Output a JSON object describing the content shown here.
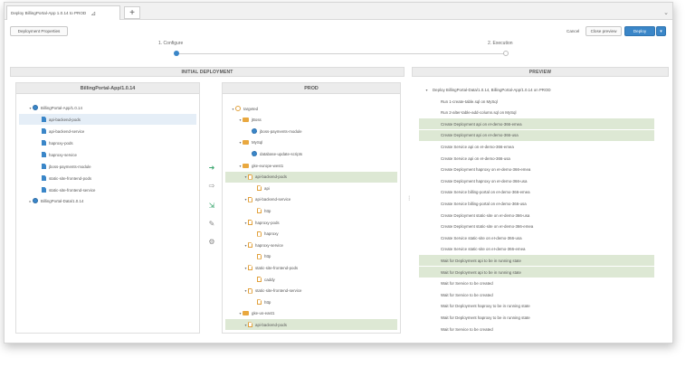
{
  "tab": {
    "title": "Deploy BillingPortal-App 1.0.14 to PROD"
  },
  "toolbar": {
    "deployment_properties": "Deployment Properties",
    "cancel": "Cancel",
    "close_preview": "Close preview",
    "deploy": "Deploy"
  },
  "steps": [
    {
      "label": "1. Configure",
      "active": true
    },
    {
      "label": "2. Execution",
      "active": false
    }
  ],
  "sections": {
    "initial_deployment": "INITIAL DEPLOYMENT",
    "preview": "PREVIEW"
  },
  "source": {
    "title": "BillingPortal-App/1.0.14",
    "items": [
      {
        "label": "BillingPortal-App/1.0.14",
        "icon": "globe"
      },
      {
        "label": "api-backend-pods",
        "icon": "file"
      },
      {
        "label": "api-backend-service",
        "icon": "file"
      },
      {
        "label": "haproxy-pods",
        "icon": "file"
      },
      {
        "label": "haproxy-service",
        "icon": "file"
      },
      {
        "label": "jboss-payments-module",
        "icon": "file"
      },
      {
        "label": "static-site-frontend-pods",
        "icon": "file"
      },
      {
        "label": "static-site-frontend-service",
        "icon": "file"
      },
      {
        "label": "BillingPortal-Data/1.0.14",
        "icon": "globe"
      }
    ]
  },
  "target": {
    "title": "PROD",
    "items": [
      {
        "label": "targeted"
      },
      {
        "label": "jBoss"
      },
      {
        "label": "jboss-payments-module"
      },
      {
        "label": "MySql"
      },
      {
        "label": "database-update-scripts"
      },
      {
        "label": "gke-europe-west1"
      },
      {
        "label": "api-backend-pods"
      },
      {
        "label": "api"
      },
      {
        "label": "api-backend-service"
      },
      {
        "label": "http"
      },
      {
        "label": "haproxy-pods"
      },
      {
        "label": "haproxy"
      },
      {
        "label": "haproxy-service"
      },
      {
        "label": "http"
      },
      {
        "label": "static-site-frontend-pods"
      },
      {
        "label": "caddy"
      },
      {
        "label": "static-site-frontend-service"
      },
      {
        "label": "http"
      },
      {
        "label": "gke-us-east1"
      },
      {
        "label": "api-backend-pods"
      }
    ]
  },
  "preview": {
    "root": "Deploy BillingPortal-Data/1.0.14, BillingPortal-App/1.0.14 on PROD",
    "items": [
      {
        "label": "Run 1-create-table.sql on MySql"
      },
      {
        "label": "Run 2-alter-table-add-column.sql on MySql"
      },
      {
        "label": "Create Deployment api on eI-demo-366-emea"
      },
      {
        "label": "Create Deployment api on eI-demo-366-usa"
      },
      {
        "label": "Create Service api on eI-demo-366-emea"
      },
      {
        "label": "Create Service api on eI-demo-366-usa"
      },
      {
        "label": "Create Deployment haproxy on eI-demo-366-emea"
      },
      {
        "label": "Create Deployment haproxy on eI-demo-366-usa"
      },
      {
        "label": "Create Service billing-portal on eI-demo-366-emea"
      },
      {
        "label": "Create Service billing-portal on eI-demo-366-usa"
      },
      {
        "label": "Create Deployment static-site on eI-demo-366-usa"
      },
      {
        "label": "Create Deployment static-site on eI-demo-366-emea"
      },
      {
        "label": "Create Service static-site on eI-demo-366-usa"
      },
      {
        "label": "Create Service static-site on eI-demo-366-emea"
      },
      {
        "label": "Wait for Deployment api to be in running state"
      },
      {
        "label": "Wait for Deployment api to be in running state"
      },
      {
        "label": "Wait for Service to be created"
      },
      {
        "label": "Wait for Service to be created"
      },
      {
        "label": "Wait for Deployment haproxy to be in running state"
      },
      {
        "label": "Wait for Deployment haproxy to be in running state"
      },
      {
        "label": "Wait for Service to be created"
      }
    ]
  },
  "colors": {
    "accent": "#3a86c8",
    "highlight": "#dde8d4",
    "folder": "#e9a83f"
  }
}
